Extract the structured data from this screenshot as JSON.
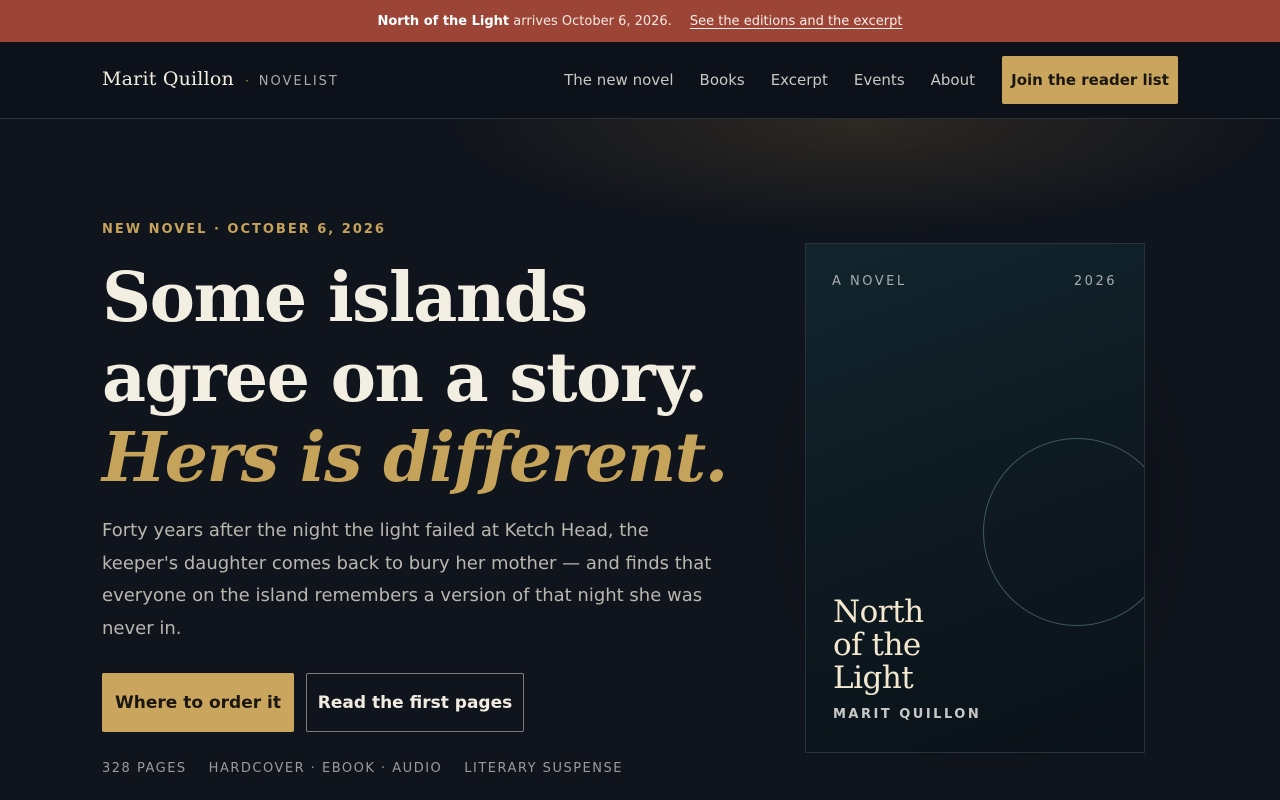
{
  "announcement": {
    "title": "North of the Light",
    "text": " arrives October 6, 2026.",
    "link": "See the editions and the excerpt"
  },
  "header": {
    "brand_name": "Marit Quillon",
    "brand_separator": "·",
    "brand_role": "NOVELIST",
    "nav": [
      "The new novel",
      "Books",
      "Excerpt",
      "Events",
      "About"
    ],
    "cta": "Join the reader list"
  },
  "hero": {
    "eyebrow": "NEW NOVEL · OCTOBER 6, 2026",
    "headline_line1": "Some islands",
    "headline_line2": "agree on a story.",
    "headline_accent": "Hers is different.",
    "lede": "Forty years after the night the light failed at Ketch Head, the keeper's daughter comes back to bury her mother — and finds that everyone on the island remembers a version of that night she was never in.",
    "primary_button": "Where to order it",
    "secondary_button": "Read the first pages",
    "meta": [
      "328 PAGES",
      "HARDCOVER · EBOOK · AUDIO",
      "LITERARY SUSPENSE"
    ]
  },
  "cover": {
    "label": "A NOVEL",
    "year": "2026",
    "title_lines": [
      "North",
      "of the",
      "Light"
    ],
    "author": "MARIT QUILLON"
  },
  "colors": {
    "background": "#10141c",
    "announcement_bar": "#9c4536",
    "accent_gold": "#c9a55e",
    "cover_teal": "#12252d"
  }
}
